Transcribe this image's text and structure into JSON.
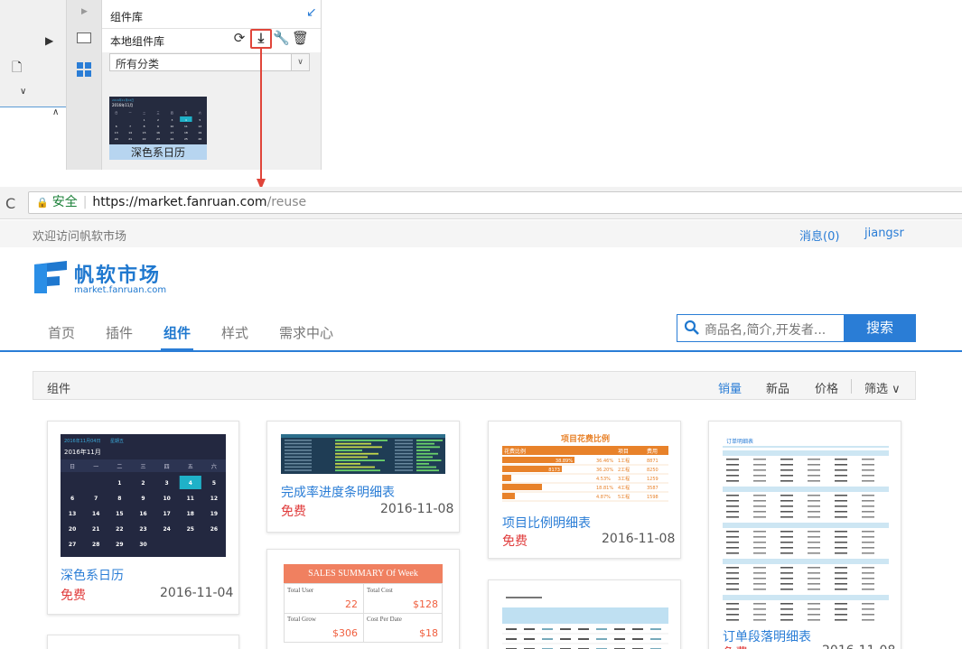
{
  "designer": {
    "panel_title": "组件库",
    "local_lib_label": "本地组件库",
    "category_select": "所有分类",
    "thumb_title": "2016年11月",
    "thumb_caption": "深色系日历"
  },
  "browser": {
    "secure_label": "安全",
    "url_host": "https://market.fanruan.com",
    "url_path": "/reuse"
  },
  "topbar": {
    "welcome": "欢迎访问帆软市场",
    "messages": "消息(0)",
    "username": "jiangsr"
  },
  "logo": {
    "name_cn": "帆软市场",
    "domain": "market.fanruan.com"
  },
  "nav": {
    "items": [
      "首页",
      "插件",
      "组件",
      "样式",
      "需求中心"
    ],
    "active": "组件"
  },
  "search": {
    "placeholder": "商品名,简介,开发者...",
    "button": "搜索"
  },
  "filter": {
    "title": "组件",
    "sort_sales": "销量",
    "sort_new": "新品",
    "sort_price": "价格",
    "filter": "筛选 ∨"
  },
  "cards": [
    {
      "title": "深色系日历",
      "price": "免费",
      "date": "2016-11-04"
    },
    {
      "title": "完成率进度条明细表",
      "price": "免费",
      "date": "2016-11-08"
    },
    {
      "title": "项目比例明细表",
      "price": "免费",
      "date": "2016-11-08"
    },
    {
      "title": "订单段落明细表",
      "price": "免费",
      "date": "2016-11-08"
    }
  ],
  "calendar": {
    "title": "2016年11月",
    "header_label": "2016年11月04日",
    "header_sub": "星期五",
    "weekdays": [
      "日",
      "一",
      "二",
      "三",
      "四",
      "五",
      "六"
    ],
    "rows": [
      [
        "",
        "",
        "1",
        "2",
        "3",
        "4",
        "5"
      ],
      [
        "6",
        "7",
        "8",
        "9",
        "10",
        "11",
        "12"
      ],
      [
        "13",
        "14",
        "15",
        "16",
        "17",
        "18",
        "19"
      ],
      [
        "20",
        "21",
        "22",
        "23",
        "24",
        "25",
        "26"
      ],
      [
        "27",
        "28",
        "29",
        "30",
        "",
        "",
        ""
      ]
    ],
    "selected": "4"
  },
  "ratio_table": {
    "title": "项目花费比例",
    "headers": [
      "花费比例",
      "项目",
      "费用"
    ],
    "rows": [
      [
        "38.89%",
        "36.46%",
        "1工程",
        "8871"
      ],
      [
        "8173",
        "36.20%",
        "2工程",
        "8250"
      ],
      [
        "",
        "4.53%",
        "3工程",
        "1259"
      ],
      [
        "",
        "18.81%",
        "4工程",
        "3587"
      ],
      [
        "",
        "4.87%",
        "5工程",
        "1598"
      ]
    ]
  },
  "order_table": {
    "title": "订单明细表"
  },
  "sales": {
    "title": "SALES SUMMARY Of Week",
    "cells": [
      {
        "label": "Total User",
        "value": "22"
      },
      {
        "label": "Total Cost",
        "value": "$128"
      },
      {
        "label": "Total Grow",
        "value": "$306"
      },
      {
        "label": "Cost Per Date",
        "value": "$18"
      }
    ]
  }
}
